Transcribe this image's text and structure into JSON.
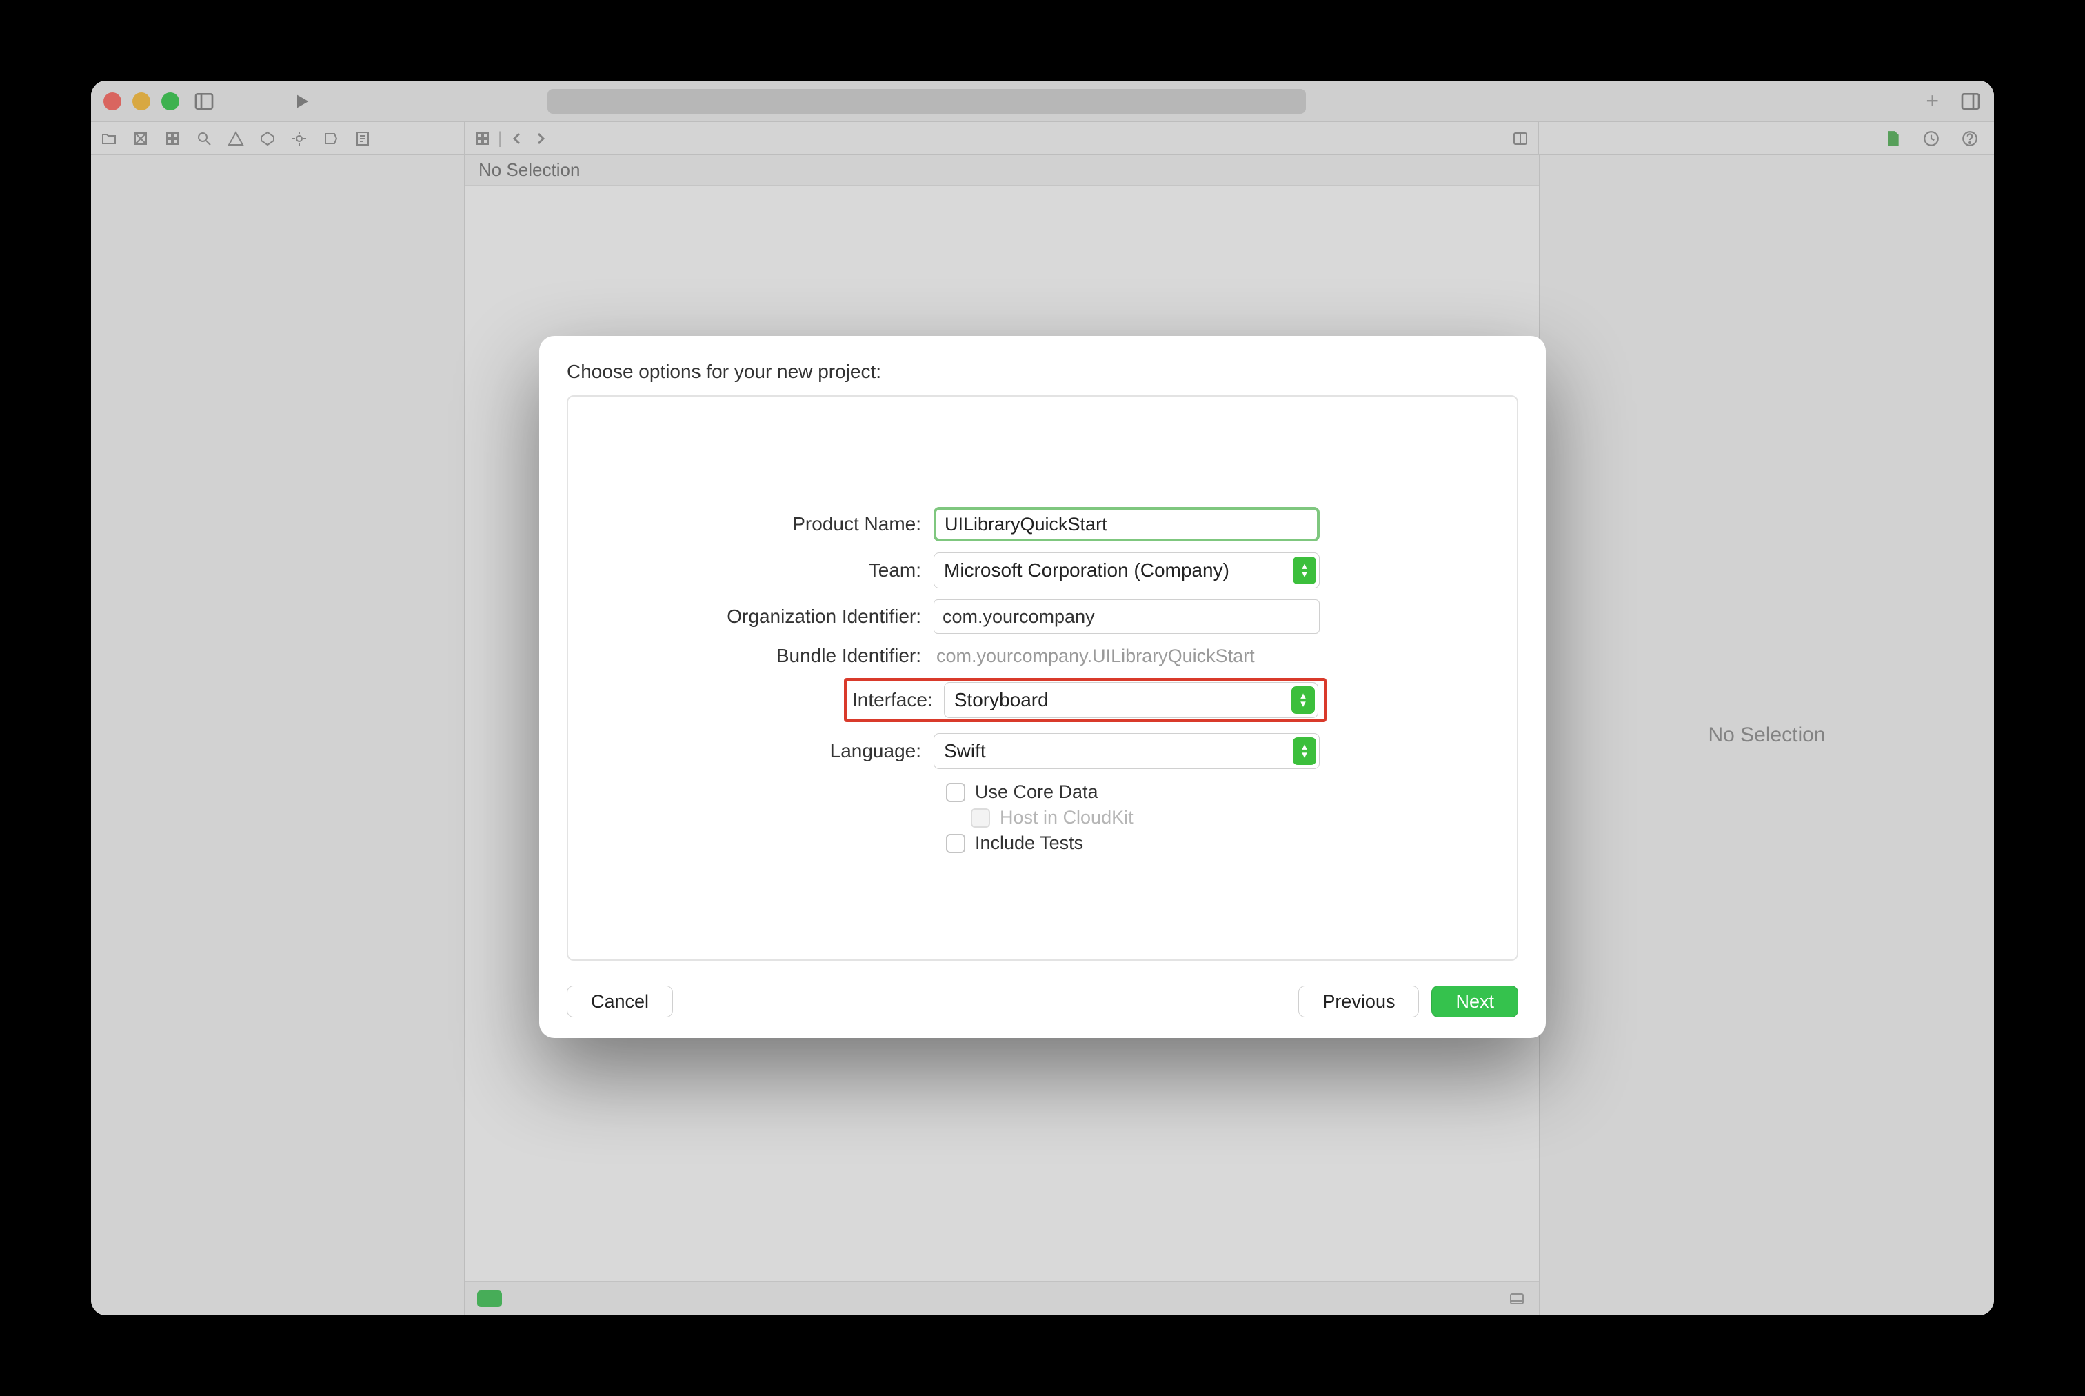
{
  "window": {
    "no_selection": "No Selection",
    "inspector_no_selection": "No Selection"
  },
  "sheet": {
    "title": "Choose options for your new project:",
    "labels": {
      "product_name": "Product Name:",
      "team": "Team:",
      "org_id": "Organization Identifier:",
      "bundle_id": "Bundle Identifier:",
      "interface": "Interface:",
      "language": "Language:"
    },
    "values": {
      "product_name": "UILibraryQuickStart",
      "team": "Microsoft Corporation (Company)",
      "org_id": "com.yourcompany",
      "bundle_id": "com.yourcompany.UILibraryQuickStart",
      "interface": "Storyboard",
      "language": "Swift"
    },
    "checkboxes": {
      "use_core_data": "Use Core Data",
      "host_cloudkit": "Host in CloudKit",
      "include_tests": "Include Tests"
    },
    "buttons": {
      "cancel": "Cancel",
      "previous": "Previous",
      "next": "Next"
    },
    "highlight_field": "interface"
  }
}
